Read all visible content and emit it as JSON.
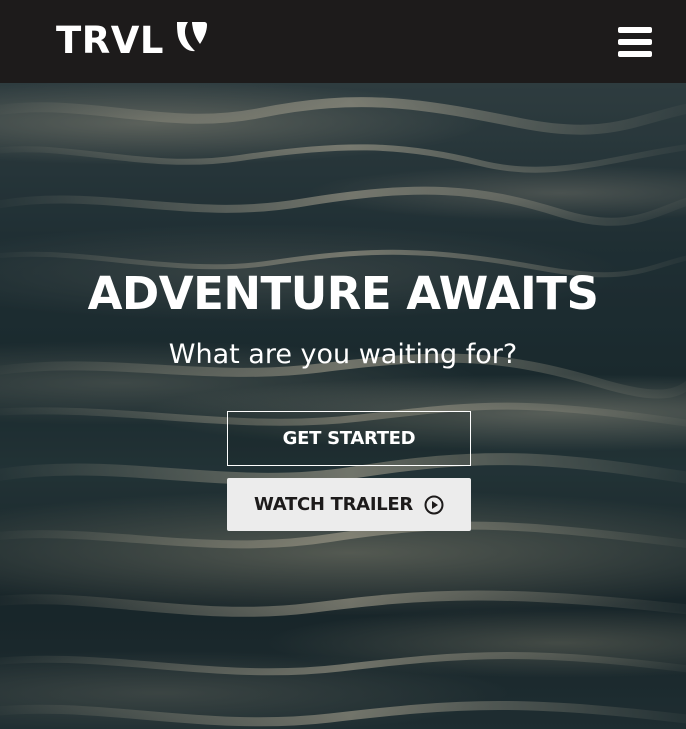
{
  "header": {
    "brand_text": "TRVL",
    "brand_logo_icon": "typo3-logo-icon",
    "menu_icon": "hamburger-menu-icon"
  },
  "hero": {
    "title": "ADVENTURE AWAITS",
    "subtitle": "What are you waiting for?",
    "primary_button_label": "GET STARTED",
    "secondary_button_label": "WATCH TRAILER",
    "secondary_button_icon": "play-circle-icon"
  },
  "colors": {
    "navbar_bg": "#1d1b1b",
    "text": "#ffffff",
    "light_button_bg": "#ececec"
  }
}
